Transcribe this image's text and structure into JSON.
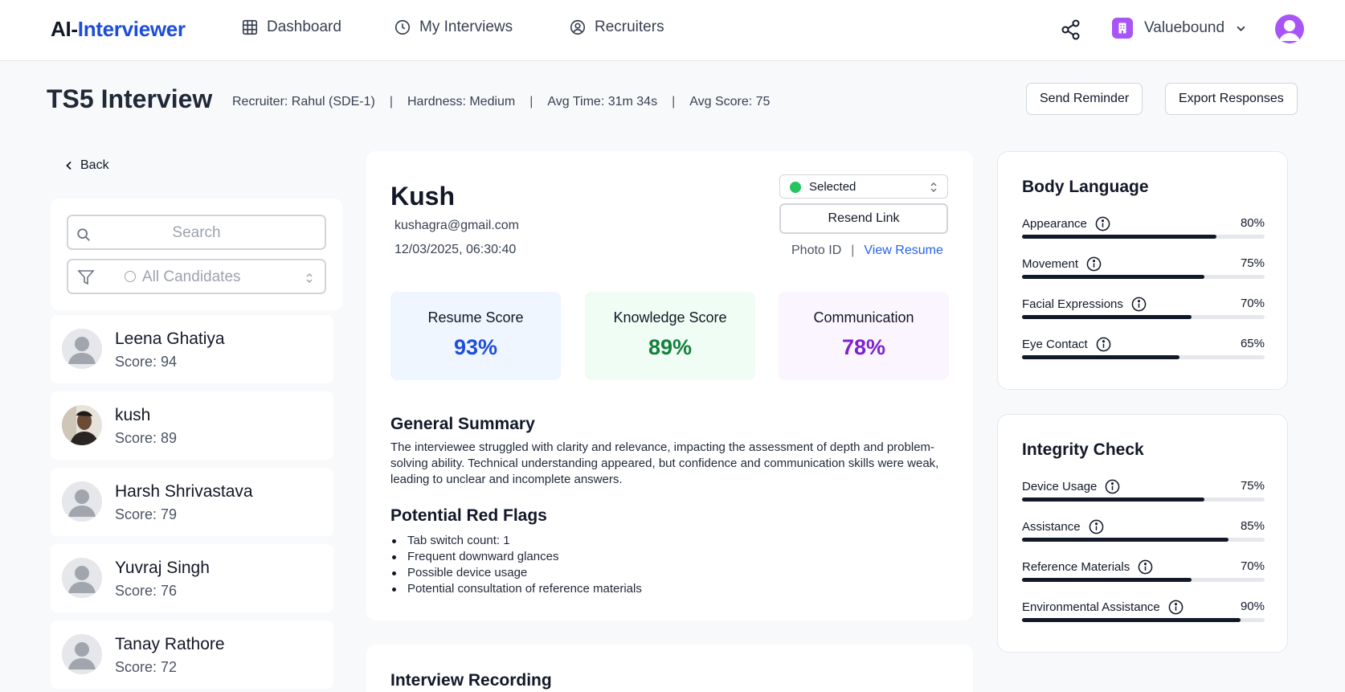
{
  "app": {
    "logo_part1": "AI-",
    "logo_part2": "Interviewer"
  },
  "nav": {
    "items": [
      {
        "label": "Dashboard",
        "icon": "grid-icon"
      },
      {
        "label": "My Interviews",
        "icon": "clock-icon"
      },
      {
        "label": "Recruiters",
        "icon": "user-circle-icon"
      }
    ]
  },
  "org": {
    "name": "Valuebound"
  },
  "header": {
    "title": "TS5 Interview",
    "recruiter": "Recruiter: Rahul (SDE-1)",
    "hardness": "Hardness: Medium",
    "avg_time": "Avg Time: 31m 34s",
    "avg_score": "Avg Score: 75",
    "send_reminder": "Send Reminder",
    "export_responses": "Export Responses"
  },
  "sidebar": {
    "back_label": "Back",
    "search_placeholder": "Search",
    "filter_value": "All Candidates",
    "candidates": [
      {
        "name": "Leena Ghatiya",
        "score": "Score: 94"
      },
      {
        "name": "kush",
        "score": "Score: 89"
      },
      {
        "name": "Harsh Shrivastava",
        "score": "Score: 79"
      },
      {
        "name": "Yuvraj Singh",
        "score": "Score: 76"
      },
      {
        "name": "Tanay Rathore",
        "score": "Score: 72"
      }
    ]
  },
  "candidate": {
    "name": "Kush",
    "email": "kushagra@gmail.com",
    "datetime": "12/03/2025, 06:30:40",
    "status": "Selected",
    "resend_link": "Resend Link",
    "photo_id": "Photo ID",
    "view_resume": "View Resume"
  },
  "scores": [
    {
      "label": "Resume Score",
      "value": "93%",
      "bg": "#eff6ff",
      "color": "#1d4ed8"
    },
    {
      "label": "Knowledge Score",
      "value": "89%",
      "bg": "#f0fdf4",
      "color": "#15803d"
    },
    {
      "label": "Communication",
      "value": "78%",
      "bg": "#faf5ff",
      "color": "#7e22ce"
    }
  ],
  "summary": {
    "heading": "General Summary",
    "text": "The interviewee struggled with clarity and relevance, impacting the assessment of depth and problem-solving ability. Technical understanding appeared, but confidence and communication skills were weak, leading to unclear and incomplete answers."
  },
  "red_flags": {
    "heading": "Potential Red Flags",
    "items": [
      "Tab switch count: 1",
      "Frequent downward glances",
      "Possible device usage",
      "Potential consultation of reference materials"
    ]
  },
  "recording": {
    "heading": "Interview Recording"
  },
  "body_language": {
    "title": "Body Language",
    "metrics": [
      {
        "label": "Appearance",
        "value": "80%",
        "pct": 80
      },
      {
        "label": "Movement",
        "value": "75%",
        "pct": 75
      },
      {
        "label": "Facial Expressions",
        "value": "70%",
        "pct": 70
      },
      {
        "label": "Eye Contact",
        "value": "65%",
        "pct": 65
      }
    ]
  },
  "integrity": {
    "title": "Integrity Check",
    "metrics": [
      {
        "label": "Device Usage",
        "value": "75%",
        "pct": 75
      },
      {
        "label": "Assistance",
        "value": "85%",
        "pct": 85
      },
      {
        "label": "Reference Materials",
        "value": "70%",
        "pct": 70
      },
      {
        "label": "Environmental Assistance",
        "value": "90%",
        "pct": 90
      }
    ]
  },
  "colors": {
    "accent": "#1d4ed8",
    "purple": "#a855f7",
    "success": "#22c55e"
  }
}
